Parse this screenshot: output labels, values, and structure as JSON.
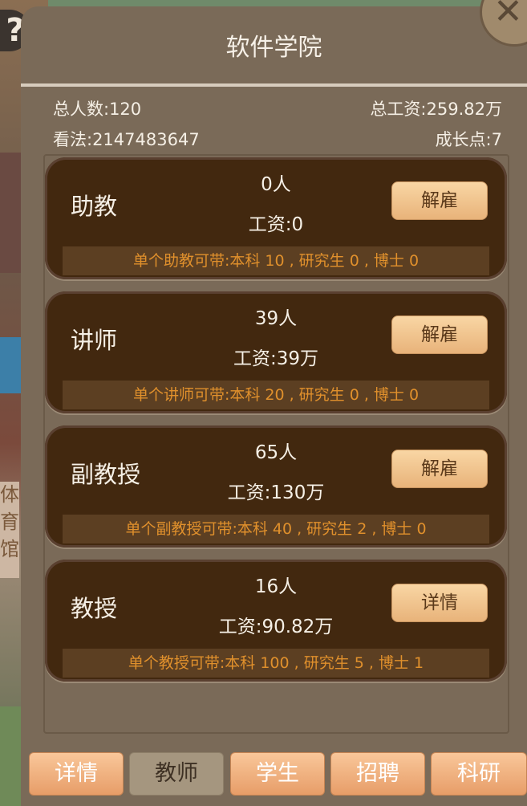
{
  "panel": {
    "title": "软件学院",
    "stats": {
      "total_people": "总人数:120",
      "total_salary": "总工资:259.82万",
      "opinion": "看法:2147483647",
      "growth_points": "成长点:7"
    }
  },
  "cards": [
    {
      "name": "助教",
      "count": "0人",
      "salary": "工资:0",
      "button": "解雇",
      "capacity": "单个助教可带:本科 10 , 研究生 0 , 博士 0"
    },
    {
      "name": "讲师",
      "count": "39人",
      "salary": "工资:39万",
      "button": "解雇",
      "capacity": "单个讲师可带:本科 20 , 研究生 0 , 博士 0"
    },
    {
      "name": "副教授",
      "count": "65人",
      "salary": "工资:130万",
      "button": "解雇",
      "capacity": "单个副教授可带:本科 40 , 研究生 2 , 博士 0"
    },
    {
      "name": "教授",
      "count": "16人",
      "salary": "工资:90.82万",
      "button": "详情",
      "capacity": "单个教授可带:本科 100 , 研究生 5 , 博士 1"
    }
  ],
  "tabs": [
    {
      "label": "详情",
      "active": false
    },
    {
      "label": "教师",
      "active": true
    },
    {
      "label": "学生",
      "active": false
    },
    {
      "label": "招聘",
      "active": false
    },
    {
      "label": "科研",
      "active": false
    }
  ],
  "background": {
    "sign_text": "体育馆",
    "help_glyph": "?",
    "close_glyph": "✕"
  },
  "colors": {
    "panel": "#7a6a58",
    "card": "#42280f",
    "capacity_text": "#e0902c",
    "button": "#e8b37a"
  }
}
